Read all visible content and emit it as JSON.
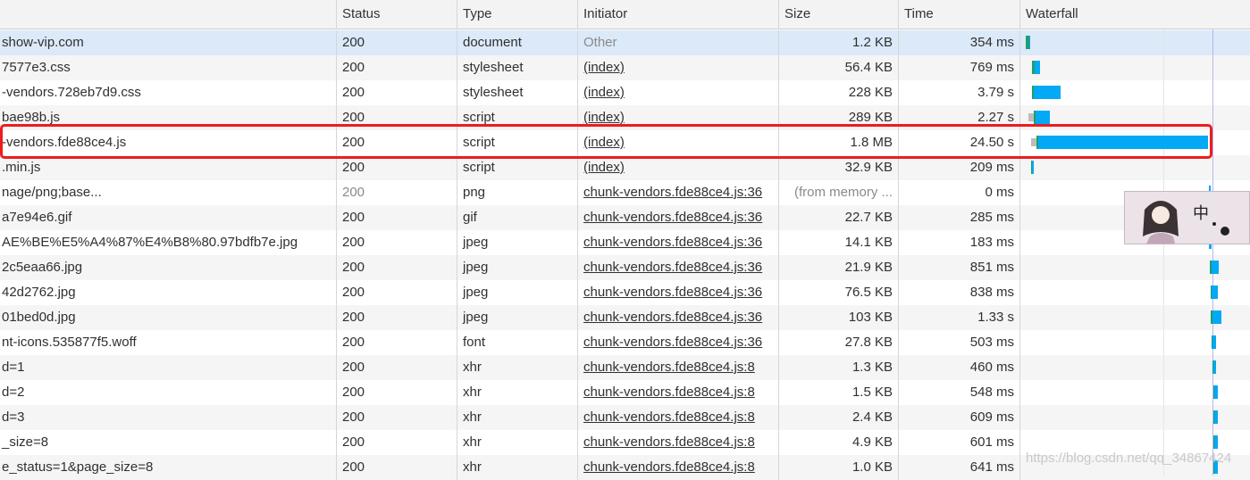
{
  "columns": {
    "name": "",
    "status": "Status",
    "type": "Type",
    "initiator": "Initiator",
    "size": "Size",
    "time": "Time",
    "waterfall": "Waterfall"
  },
  "rows": [
    {
      "name": "show-vip.com",
      "status": "200",
      "type": "document",
      "initiator": "Other",
      "size": "1.2 KB",
      "time": "354 ms"
    },
    {
      "name": "7577e3.css",
      "status": "200",
      "type": "stylesheet",
      "initiator": "(index)",
      "size": "56.4 KB",
      "time": "769 ms"
    },
    {
      "name": "-vendors.728eb7d9.css",
      "status": "200",
      "type": "stylesheet",
      "initiator": "(index)",
      "size": "228 KB",
      "time": "3.79 s"
    },
    {
      "name": "bae98b.js",
      "status": "200",
      "type": "script",
      "initiator": "(index)",
      "size": "289 KB",
      "time": "2.27 s"
    },
    {
      "name": "-vendors.fde88ce4.js",
      "status": "200",
      "type": "script",
      "initiator": "(index)",
      "size": "1.8 MB",
      "time": "24.50 s"
    },
    {
      "name": ".min.js",
      "status": "200",
      "type": "script",
      "initiator": "(index)",
      "size": "32.9 KB",
      "time": "209 ms"
    },
    {
      "name": "nage/png;base...",
      "status": "200",
      "type": "png",
      "initiator": "chunk-vendors.fde88ce4.js:36",
      "size": "(from memory ...",
      "time": "0 ms"
    },
    {
      "name": "a7e94e6.gif",
      "status": "200",
      "type": "gif",
      "initiator": "chunk-vendors.fde88ce4.js:36",
      "size": "22.7 KB",
      "time": "285 ms"
    },
    {
      "name": "AE%BE%E5%A4%87%E4%B8%80.97bdfb7e.jpg",
      "status": "200",
      "type": "jpeg",
      "initiator": "chunk-vendors.fde88ce4.js:36",
      "size": "14.1 KB",
      "time": "183 ms"
    },
    {
      "name": "2c5eaa66.jpg",
      "status": "200",
      "type": "jpeg",
      "initiator": "chunk-vendors.fde88ce4.js:36",
      "size": "21.9 KB",
      "time": "851 ms"
    },
    {
      "name": "42d2762.jpg",
      "status": "200",
      "type": "jpeg",
      "initiator": "chunk-vendors.fde88ce4.js:36",
      "size": "76.5 KB",
      "time": "838 ms"
    },
    {
      "name": "01bed0d.jpg",
      "status": "200",
      "type": "jpeg",
      "initiator": "chunk-vendors.fde88ce4.js:36",
      "size": "103 KB",
      "time": "1.33 s"
    },
    {
      "name": "nt-icons.535877f5.woff",
      "status": "200",
      "type": "font",
      "initiator": "chunk-vendors.fde88ce4.js:36",
      "size": "27.8 KB",
      "time": "503 ms"
    },
    {
      "name": "d=1",
      "status": "200",
      "type": "xhr",
      "initiator": "chunk-vendors.fde88ce4.js:8",
      "size": "1.3 KB",
      "time": "460 ms"
    },
    {
      "name": "d=2",
      "status": "200",
      "type": "xhr",
      "initiator": "chunk-vendors.fde88ce4.js:8",
      "size": "1.5 KB",
      "time": "548 ms"
    },
    {
      "name": "d=3",
      "status": "200",
      "type": "xhr",
      "initiator": "chunk-vendors.fde88ce4.js:8",
      "size": "2.4 KB",
      "time": "609 ms"
    },
    {
      "name": "_size=8",
      "status": "200",
      "type": "xhr",
      "initiator": "chunk-vendors.fde88ce4.js:8",
      "size": "4.9 KB",
      "time": "601 ms"
    },
    {
      "name": "e_status=1&page_size=8",
      "status": "200",
      "type": "xhr",
      "initiator": "chunk-vendors.fde88ce4.js:8",
      "size": "1.0 KB",
      "time": "641 ms"
    }
  ],
  "watermark": "https://blog.csdn.net/qq_34867424",
  "colors": {
    "waiting": "#1f9f6a",
    "receiving": "#03a9f4",
    "highlight": "#ee1c1c"
  }
}
